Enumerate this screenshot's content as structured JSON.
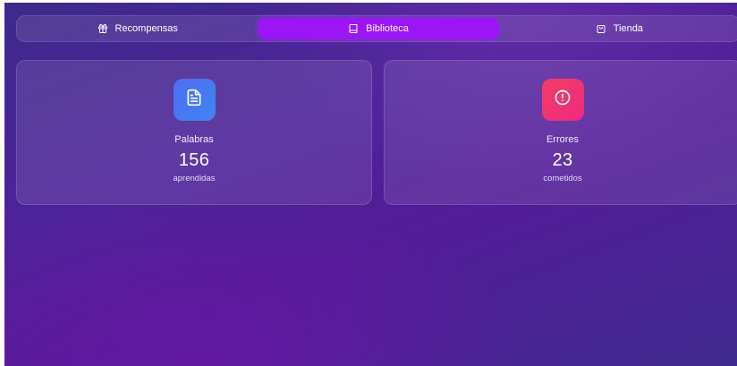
{
  "tabs": [
    {
      "label": "Recompensas",
      "icon": "gift-icon",
      "active": false
    },
    {
      "label": "Biblioteca",
      "icon": "book-icon",
      "active": true
    },
    {
      "label": "Tienda",
      "icon": "shopping-bag-icon",
      "active": false
    }
  ],
  "stats": {
    "words": {
      "label": "Palabras",
      "value": "156",
      "sub": "aprendidas",
      "icon": "document-icon",
      "color": "#4f6cf5"
    },
    "errors": {
      "label": "Errores",
      "value": "23",
      "sub": "cometidos",
      "icon": "alert-circle-icon",
      "color": "#f13e63"
    }
  },
  "colors": {
    "active_tab": "#9b15f5",
    "background": "#4e2399"
  }
}
